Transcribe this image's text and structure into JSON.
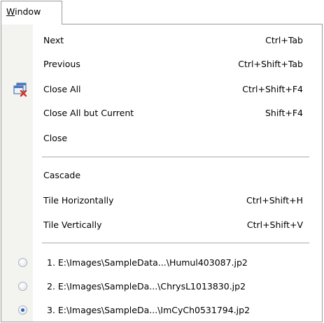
{
  "menubar": {
    "title": "Window",
    "title_accel": "W",
    "title_rest": "indow"
  },
  "menu": {
    "items": [
      {
        "label": "Next",
        "shortcut": "Ctrl+Tab"
      },
      {
        "label": "Previous",
        "shortcut": "Ctrl+Shift+Tab"
      },
      {
        "label": "Close All",
        "shortcut": "Ctrl+Shift+F4",
        "icon": "close-all-windows-icon"
      },
      {
        "label": "Close All but Current",
        "shortcut": "Shift+F4"
      },
      {
        "label": "Close",
        "shortcut": ""
      }
    ],
    "arrange": [
      {
        "label": "Cascade",
        "shortcut": ""
      },
      {
        "label": "Tile Horizontally",
        "shortcut": "Ctrl+Shift+H"
      },
      {
        "label": "Tile Vertically",
        "shortcut": "Ctrl+Shift+V"
      }
    ],
    "recent": [
      {
        "label": "1.  E:\\Images\\SampleData...\\Humul403087.jp2",
        "checked": false
      },
      {
        "label": "2.  E:\\Images\\SampleDa...\\ChrysL1013830.jp2",
        "checked": false
      },
      {
        "label": "3.  E:\\Images\\SampleDa...\\ImCyCh0531794.jp2",
        "checked": true
      }
    ]
  },
  "colors": {
    "gutter": "#f3f3f0",
    "border": "#9a9a9a",
    "radio_dot": "#2f5fc4"
  }
}
